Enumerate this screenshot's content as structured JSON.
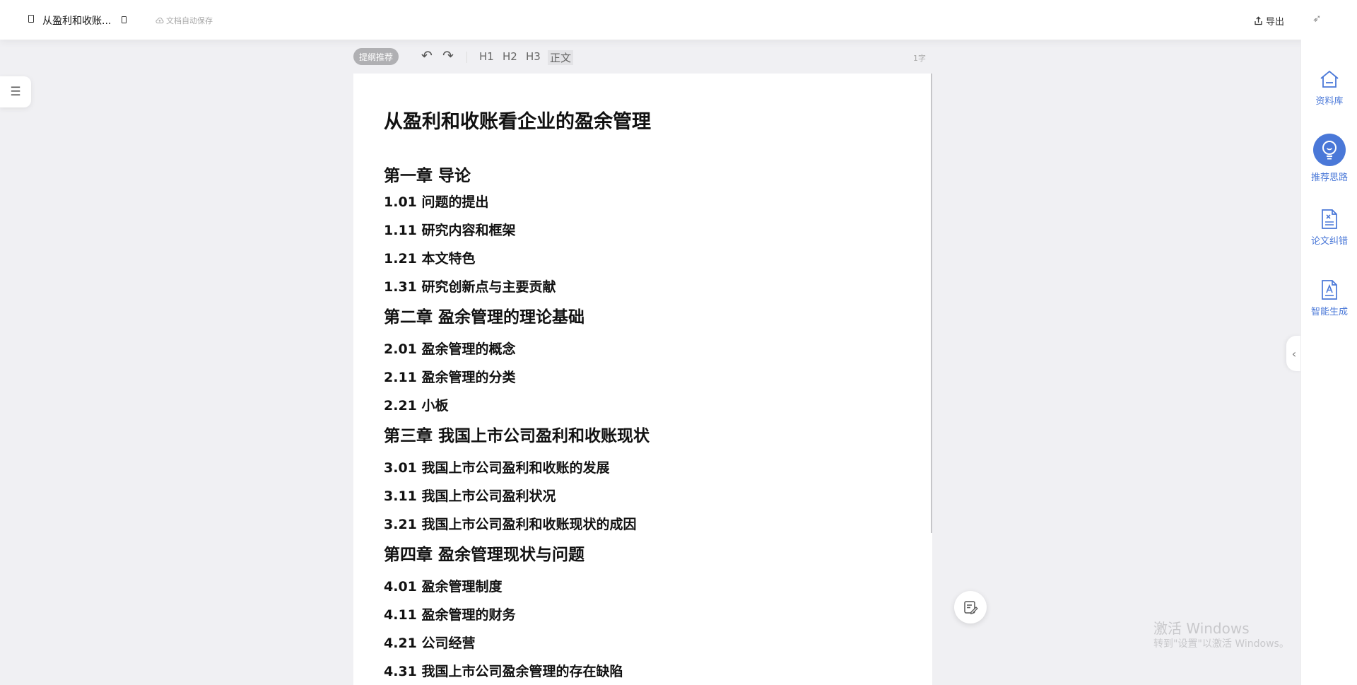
{
  "header": {
    "doc_title": "从盈利和收账...",
    "autosave_label": "文档自动保存",
    "export_label": "导出"
  },
  "toolbar": {
    "outline_recommend_label": "提纲推荐",
    "h1_label": "H1",
    "h2_label": "H2",
    "h3_label": "H3",
    "body_label": "正文",
    "word_count": "1字"
  },
  "document": {
    "title": "从盈利和收账看企业的盈余管理",
    "toc": [
      {
        "level": "chapter",
        "text": "第一章 导论"
      },
      {
        "level": "section",
        "text": "1.01 问题的提出"
      },
      {
        "level": "section",
        "text": "1.11 研究内容和框架"
      },
      {
        "level": "section",
        "text": "1.21 本文特色"
      },
      {
        "level": "section",
        "text": "1.31 研究创新点与主要贡献"
      },
      {
        "level": "chapter",
        "text": "第二章 盈余管理的理论基础"
      },
      {
        "level": "section",
        "text": "2.01 盈余管理的概念"
      },
      {
        "level": "section",
        "text": "2.11 盈余管理的分类"
      },
      {
        "level": "section",
        "text": "2.21 小板"
      },
      {
        "level": "chapter",
        "text": "第三章 我国上市公司盈利和收账现状"
      },
      {
        "level": "section",
        "text": "3.01 我国上市公司盈利和收账的发展"
      },
      {
        "level": "section",
        "text": "3.11 我国上市公司盈利状况"
      },
      {
        "level": "section",
        "text": "3.21 我国上市公司盈利和收账现状的成因"
      },
      {
        "level": "chapter",
        "text": "第四章 盈余管理现状与问题"
      },
      {
        "level": "section",
        "text": "4.01 盈余管理制度"
      },
      {
        "level": "section",
        "text": "4.11 盈余管理的财务"
      },
      {
        "level": "section",
        "text": "4.21 公司经营"
      },
      {
        "level": "section",
        "text": "4.31 我国上市公司盈余管理的存在缺陷"
      }
    ]
  },
  "right_panel": {
    "library_label": "资料库",
    "ideas_label": "推荐思路",
    "correction_label": "论文纠错",
    "generate_label": "智能生成"
  },
  "watermark": {
    "line1": "激活 Windows",
    "line2": "转到\"设置\"以激活 Windows。"
  },
  "colors": {
    "accent": "#4a78d8",
    "outline_button_bg": "#b0b0b3",
    "page_bg": "#f0f0f3"
  }
}
